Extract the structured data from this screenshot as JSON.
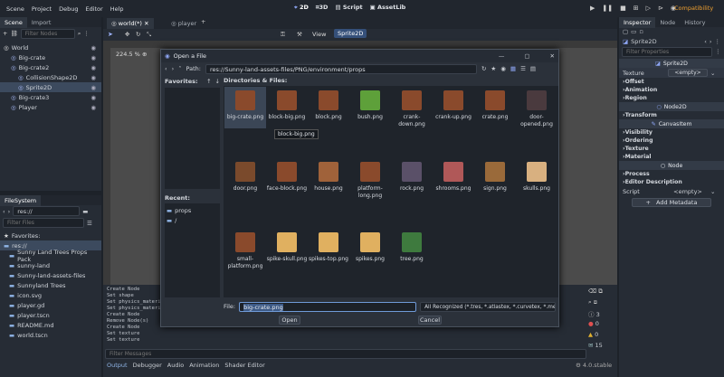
{
  "menu": [
    "Scene",
    "Project",
    "Debug",
    "Editor",
    "Help"
  ],
  "workspaces": {
    "w2d": "2D",
    "w3d": "3D",
    "script": "Script",
    "assetlib": "AssetLib"
  },
  "renderer": "Compatibility",
  "scene_dock": {
    "tabs": [
      "Scene",
      "Import"
    ],
    "filter_placeholder": "Filter Nodes",
    "nodes": [
      {
        "label": "World",
        "depth": 0,
        "color": "#e0e0e0"
      },
      {
        "label": "Big-crate",
        "depth": 1,
        "color": "#a5b7f3"
      },
      {
        "label": "Big-crate2",
        "depth": 1,
        "color": "#a5b7f3"
      },
      {
        "label": "CollisionShape2D",
        "depth": 2,
        "color": "#a5b7f3"
      },
      {
        "label": "Sprite2D",
        "depth": 2,
        "color": "#a5b7f3"
      },
      {
        "label": "Big-crate3",
        "depth": 1,
        "color": "#a5b7f3"
      },
      {
        "label": "Player",
        "depth": 1,
        "color": "#a5b7f3"
      }
    ]
  },
  "filesystem": {
    "title": "FileSystem",
    "path": "res://",
    "filter_placeholder": "Filter Files",
    "items": [
      {
        "label": "Favorites:",
        "depth": 0
      },
      {
        "label": "res://",
        "depth": 0
      },
      {
        "label": "Sunny Land Trees Props Pack",
        "depth": 1
      },
      {
        "label": "sunny-land",
        "depth": 1
      },
      {
        "label": "Sunny-land-assets-files",
        "depth": 1
      },
      {
        "label": "Sunnyland Trees",
        "depth": 1
      },
      {
        "label": "icon.svg",
        "depth": 1
      },
      {
        "label": "player.gd",
        "depth": 1
      },
      {
        "label": "player.tscn",
        "depth": 1
      },
      {
        "label": "README.md",
        "depth": 1
      },
      {
        "label": "world.tscn",
        "depth": 1
      }
    ]
  },
  "editor_tabs": [
    "world(*)",
    "player"
  ],
  "viewport": {
    "zoom": "224.5 %",
    "view_label": "View",
    "node_label": "Sprite2D"
  },
  "output": {
    "lines": [
      "Create Node",
      "Set shape",
      "Set physics_material_override",
      "Set physics_material_override",
      "Create Node",
      "Remove Node(s)",
      "Create Node",
      "Set texture",
      "Set texture"
    ],
    "filter_placeholder": "Filter Messages",
    "bottom_tabs": [
      "Output",
      "Debugger",
      "Audio",
      "Animation",
      "Shader Editor"
    ],
    "counts": [
      "3",
      "0",
      "0",
      "15"
    ],
    "version": "4.0.stable"
  },
  "dialog": {
    "title": "Open a File",
    "path_label": "Path:",
    "path": "res://Sunny-land-assets-files/PNG/environment/props",
    "favorites_label": "Favorites:",
    "recent_label": "Recent:",
    "recent": [
      "props",
      "/"
    ],
    "dirs_label": "Directories & Files:",
    "files": [
      "big-crate.png",
      "block-big.png",
      "block.png",
      "bush.png",
      "crank-down.png",
      "crank-up.png",
      "crate.png",
      "door-opened.png",
      "door.png",
      "face-block.png",
      "house.png",
      "platform-long.png",
      "rock.png",
      "shrooms.png",
      "sign.png",
      "skulls.png",
      "small-platform.png",
      "spike-skull.png",
      "spikes-top.png",
      "spikes.png",
      "tree.png"
    ],
    "thumb_colors": [
      "#8a4a2c",
      "#8a4a2c",
      "#8a4a2c",
      "#5ea03a",
      "#8a4a2c",
      "#8a4a2c",
      "#8a4a2c",
      "#4a3a3e",
      "#7a4a2c",
      "#8a4a2c",
      "#a0623a",
      "#8a4a2c",
      "#5a5068",
      "#b05858",
      "#9a6a3a",
      "#d8b080",
      "#8a4a2c",
      "#e0b060",
      "#e0b060",
      "#e0b060",
      "#3e7a3e"
    ],
    "tooltip": "block-big.png",
    "file_label": "File:",
    "file_value": "big-crate.png",
    "filter": "All Recognized (*.tres, *.atlastex, *.curvetex, *.mesh",
    "open_button": "Open",
    "cancel_button": "Cancel"
  },
  "inspector": {
    "tabs": [
      "Inspector",
      "Node",
      "History"
    ],
    "node": "Sprite2D",
    "filter_placeholder": "Filter Properties",
    "class_header": "Sprite2D",
    "texture_label": "Texture",
    "texture_value": "<empty>",
    "sprite_sections": [
      "Offset",
      "Animation",
      "Region"
    ],
    "node2d_header": "Node2D",
    "node2d_sections": [
      "Transform"
    ],
    "canvas_header": "CanvasItem",
    "canvas_sections": [
      "Visibility",
      "Ordering",
      "Texture",
      "Material"
    ],
    "node_header": "Node",
    "node_sections": [
      "Process",
      "Editor Description"
    ],
    "script_label": "Script",
    "script_value": "<empty>",
    "add_metadata": "Add Metadata"
  }
}
